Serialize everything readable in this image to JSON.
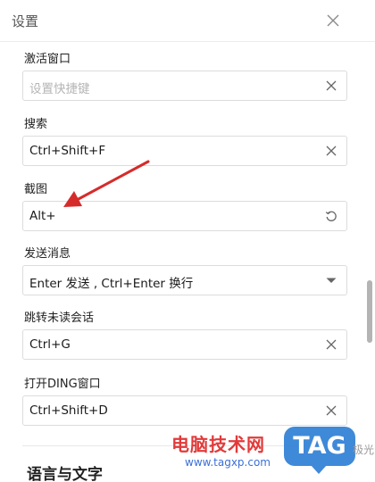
{
  "window": {
    "title": "设置"
  },
  "fields": [
    {
      "label": "激活窗口",
      "value": "",
      "placeholder": "设置快捷键",
      "action": "clear"
    },
    {
      "label": "搜索",
      "value": "Ctrl+Shift+F",
      "placeholder": "",
      "action": "clear"
    },
    {
      "label": "截图",
      "value": "Alt+",
      "placeholder": "",
      "action": "reset"
    },
    {
      "label": "发送消息",
      "value": "Enter 发送 , Ctrl+Enter 换行",
      "placeholder": "",
      "action": "dropdown"
    },
    {
      "label": "跳转未读会话",
      "value": "Ctrl+G",
      "placeholder": "",
      "action": "clear"
    },
    {
      "label": "打开DING窗口",
      "value": "Ctrl+Shift+D",
      "placeholder": "",
      "action": "clear"
    }
  ],
  "next_section": {
    "title": "语言与文字"
  },
  "annotation": {
    "color": "#d62b2b",
    "target": "截图"
  },
  "watermark": {
    "cn": "电脑技术网",
    "url": "www.tagxp.com",
    "tag": "TAG",
    "sub": "极光"
  }
}
